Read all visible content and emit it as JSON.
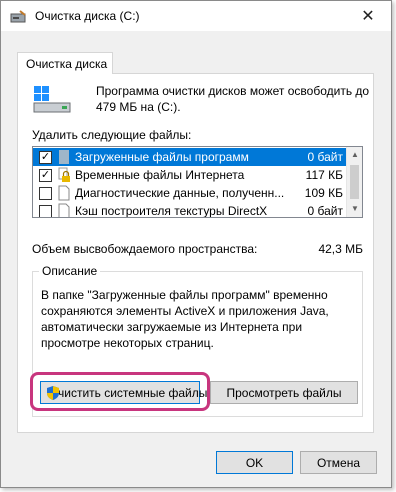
{
  "window": {
    "title": "Очистка диска  (C:)",
    "close_symbol": "✕"
  },
  "tab": {
    "label": "Очистка диска"
  },
  "info": {
    "text": "Программа очистки дисков может освободить до 479 МБ на  (C:)."
  },
  "files": {
    "label": "Удалить следующие файлы:",
    "items": [
      {
        "name": "Загруженные файлы программ",
        "size": "0 байт",
        "checked": true,
        "selected": true,
        "icon": "folder-icon"
      },
      {
        "name": "Временные файлы Интернета",
        "size": "117 КБ",
        "checked": true,
        "selected": false,
        "icon": "lock-icon"
      },
      {
        "name": "Диагностические данные, полученн...",
        "size": "109 КБ",
        "checked": false,
        "selected": false,
        "icon": "file-icon"
      },
      {
        "name": "Кэш построителя текстуры DirectX",
        "size": "0 байт",
        "checked": false,
        "selected": false,
        "icon": "file-icon"
      }
    ],
    "check_mark": "✓"
  },
  "space": {
    "label": "Объем высвобождаемого пространства:",
    "value": "42,3 МБ"
  },
  "description": {
    "title": "Описание",
    "text": "В папке \"Загруженные файлы программ\" временно сохраняются элементы ActiveX и приложения Java, автоматически загружаемые из Интернета при просмотре некоторых страниц."
  },
  "buttons": {
    "clean_system": "Очистить системные файлы",
    "view_files": "Просмотреть файлы",
    "ok": "OK",
    "cancel": "Отмена"
  },
  "colors": {
    "accent": "#0078d7",
    "highlight": "#c8357e"
  }
}
